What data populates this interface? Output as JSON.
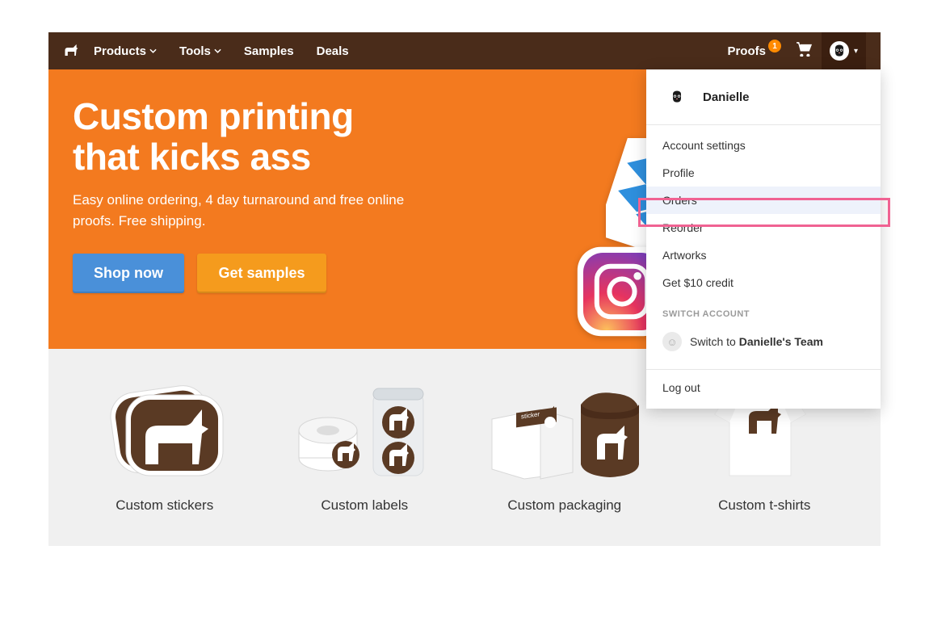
{
  "nav": {
    "items": [
      {
        "label": "Products",
        "hasDropdown": true
      },
      {
        "label": "Tools",
        "hasDropdown": true
      },
      {
        "label": "Samples",
        "hasDropdown": false
      },
      {
        "label": "Deals",
        "hasDropdown": false
      }
    ],
    "proofs_label": "Proofs",
    "proofs_badge": "1"
  },
  "hero": {
    "title_line1": "Custom printing",
    "title_line2": "that kicks ass",
    "subtitle": "Easy online ordering, 4 day turnaround and free online proofs. Free shipping.",
    "shop_btn": "Shop now",
    "samples_btn": "Get samples"
  },
  "products": [
    {
      "label": "Custom stickers"
    },
    {
      "label": "Custom labels"
    },
    {
      "label": "Custom packaging"
    },
    {
      "label": "Custom t-shirts"
    }
  ],
  "dropdown": {
    "user_name": "Danielle",
    "items": [
      "Account settings",
      "Profile",
      "Orders",
      "Reorder",
      "Artworks",
      "Get $10 credit"
    ],
    "highlighted_index": 2,
    "switch_label": "SWITCH ACCOUNT",
    "switch_prefix": "Switch to ",
    "switch_team": "Danielle's Team",
    "logout": "Log out"
  }
}
